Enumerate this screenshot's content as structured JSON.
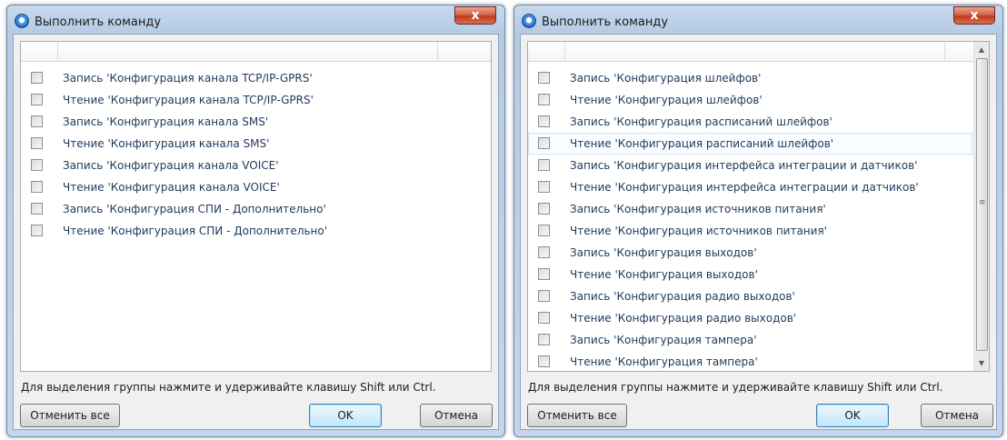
{
  "dialogs": [
    {
      "title": "Выполнить команду",
      "close_label": "x",
      "items": [
        {
          "label": "Запись 'Конфигурация канала TCP/IP-GPRS'"
        },
        {
          "label": "Чтение 'Конфигурация канала TCP/IP-GPRS'"
        },
        {
          "label": "Запись 'Конфигурация канала SMS'"
        },
        {
          "label": "Чтение 'Конфигурация канала SMS'"
        },
        {
          "label": "Запись 'Конфигурация канала VOICE'"
        },
        {
          "label": "Чтение 'Конфигурация канала VOICE'"
        },
        {
          "label": "Запись 'Конфигурация СПИ - Дополнительно'"
        },
        {
          "label": "Чтение 'Конфигурация СПИ - Дополнительно'"
        }
      ],
      "hint": "Для выделения группы нажмите и удерживайте клавишу Shift или Ctrl.",
      "buttons": {
        "deselect_all": "Отменить все",
        "ok": "OK",
        "cancel": "Отмена"
      }
    },
    {
      "title": "Выполнить команду",
      "close_label": "x",
      "items": [
        {
          "label": "Запись 'Конфигурация шлейфов'"
        },
        {
          "label": "Чтение 'Конфигурация шлейфов'"
        },
        {
          "label": "Запись 'Конфигурация расписаний шлейфов'"
        },
        {
          "label": "Чтение 'Конфигурация расписаний шлейфов'",
          "highlighted": true
        },
        {
          "label": "Запись 'Конфигурация интерфейса интеграции и датчиков'"
        },
        {
          "label": "Чтение 'Конфигурация интерфейса интеграции и датчиков'"
        },
        {
          "label": "Запись 'Конфигурация источников питания'"
        },
        {
          "label": "Чтение 'Конфигурация источников питания'"
        },
        {
          "label": "Запись 'Конфигурация выходов'"
        },
        {
          "label": "Чтение 'Конфигурация выходов'"
        },
        {
          "label": "Запись 'Конфигурация радио выходов'"
        },
        {
          "label": "Чтение 'Конфигурация радио выходов'"
        },
        {
          "label": "Запись 'Конфигурация тампера'"
        },
        {
          "label": "Чтение 'Конфигурация тампера'"
        }
      ],
      "scrollbar": {
        "up_icon": "▲",
        "down_icon": "▼",
        "grip_icon": "≡"
      },
      "hint": "Для выделения группы нажмите и удерживайте клавишу Shift или Ctrl.",
      "buttons": {
        "deselect_all": "Отменить все",
        "ok": "OK",
        "cancel": "Отмена"
      }
    }
  ]
}
